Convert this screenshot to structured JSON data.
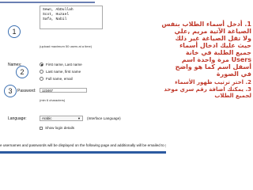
{
  "form": {
    "names_lines": [
      "Sewn, AbDullah",
      "Scot, Huzael",
      "Safa, Nabil"
    ],
    "upload_hint": "(upload maximum 50 users at a time)",
    "names_label": "Names:",
    "names_option_1": "First name, Last name",
    "names_option_2": "Last name, first name",
    "names_option_3": "Full name, email",
    "password_label": "Password:",
    "password_value": "123467",
    "password_hint": "(min 6 characters)",
    "language_label": "Language:",
    "language_value": "Arabic",
    "interface_language": "(Interface Language)",
    "checkbox_text": "Show login details",
    "bottom_text": "e usernames and passwords will be displayed on the following page and additionally will be emailed to you."
  },
  "markers": [
    "1",
    "2",
    "3"
  ],
  "instructions": {
    "item1_lines": [
      "1.  أدخل أسماء الطلاب بنفس",
      "الصياغة الآتية مريم ,علي",
      "ولا تقل الصياغة غير ذلك",
      "حيث عليك ادخال أسماء",
      "جميع الطلبة في خانة",
      "Users مرة واحدة اسم",
      "أسفل اسم كما هو واضح",
      "في الصورة"
    ],
    "item2": "2.  اختر ترتيب ظهور الأسماء",
    "item3_lines": [
      "3.  يمكنك اضافة رقم سري موحد",
      "لجميع الطلاب"
    ]
  },
  "colors": {
    "instruction_red": "#c0392b",
    "accent_blue": "#2c5aa0"
  }
}
